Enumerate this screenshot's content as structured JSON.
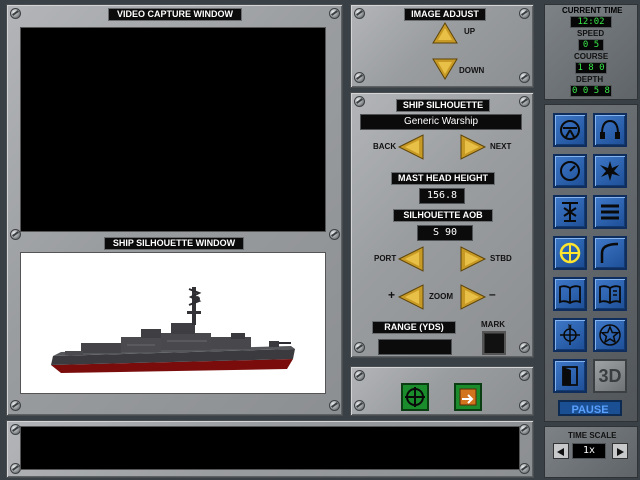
{
  "video_panel": {
    "title": "VIDEO CAPTURE WINDOW"
  },
  "silhouette_panel": {
    "title": "SHIP SILHOUETTE WINDOW"
  },
  "image_adjust": {
    "title": "IMAGE ADJUST",
    "up_label": "UP",
    "down_label": "DOWN"
  },
  "ship_silhouette": {
    "title": "SHIP SILHOUETTE",
    "ship_name": "Generic Warship",
    "back_label": "BACK",
    "next_label": "NEXT",
    "mast_head_title": "MAST HEAD HEIGHT",
    "mast_head_value": "156.8",
    "aob_title": "SILHOUETTE AOB",
    "aob_value": "S 90",
    "port_label": "PORT",
    "stbd_label": "STBD",
    "zoom_label": "ZOOM",
    "zoom_plus": "+",
    "zoom_minus": "–",
    "range_title": "RANGE (YDS)",
    "range_value": "",
    "mark_label": "MARK"
  },
  "status": {
    "time_title": "CURRENT TIME",
    "time_value": "12:02",
    "speed_title": "SPEED",
    "speed_value": "0 5",
    "course_title": "COURSE",
    "course_value": "1 8 0",
    "depth_title": "DEPTH",
    "depth_value": "0 0 5 8"
  },
  "nav_icons": [
    "helm-icon",
    "sonar-headphones-icon",
    "gauge-icon",
    "explosion-icon",
    "tower-icon",
    "menu-lines-icon",
    "periscope-crosshair-icon",
    "curve-icon",
    "book-icon",
    "book-alt-icon",
    "compass-icon",
    "star-icon",
    "door-icon",
    "3d-view"
  ],
  "pause_label": "PAUSE",
  "time_scale": {
    "title": "TIME SCALE",
    "value": "1x"
  },
  "message_bar": {
    "text": ""
  },
  "colors": {
    "lcd_green": "#38e84a",
    "button_blue": "#2a62b3",
    "pause_text": "#5aa0ff",
    "hull_red": "#7a0c0c"
  }
}
